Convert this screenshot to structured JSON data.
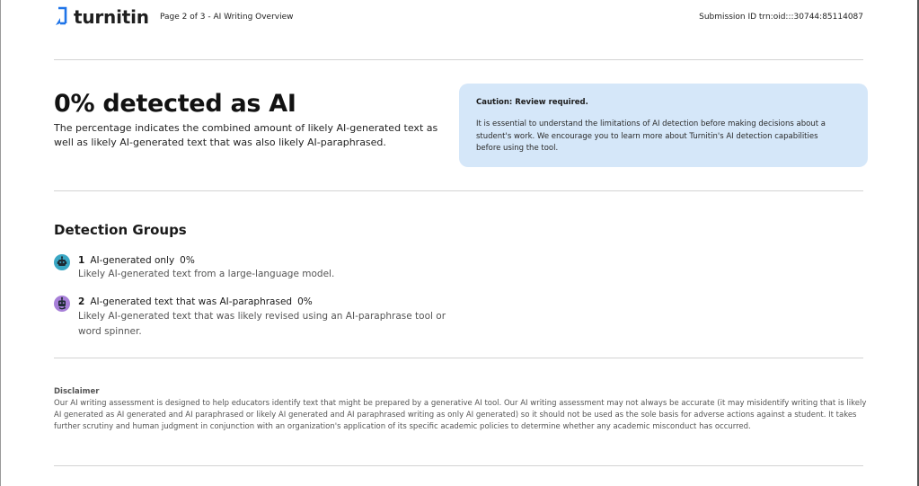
{
  "header": {
    "brand": "turnitin",
    "page_info": "Page 2 of 3 - AI Writing Overview",
    "submission_id": "Submission ID trn:oid:::30744:85114087"
  },
  "summary": {
    "headline": "0% detected as AI",
    "description": "The percentage indicates the combined amount of likely AI-generated text as well as likely AI-generated text that was also likely AI-paraphrased."
  },
  "caution": {
    "title": "Caution: Review required.",
    "body": "It is essential to understand the limitations of AI detection before making decisions about a student's work. We encourage you to learn more about Turnitin's AI detection capabilities before using the tool."
  },
  "detection_groups": {
    "title": "Detection Groups",
    "items": [
      {
        "number": "1",
        "label": "AI-generated only",
        "percent": "0%",
        "description": "Likely AI-generated text from a large-language model.",
        "icon": "robot-icon",
        "color": "#3aa7c4"
      },
      {
        "number": "2",
        "label": "AI-generated text that was AI-paraphrased",
        "percent": "0%",
        "description": "Likely AI-generated text that was likely revised using an AI-paraphrase tool or word spinner.",
        "icon": "robot-paraphrase-icon",
        "color": "#a77fd8"
      }
    ]
  },
  "disclaimer": {
    "title": "Disclaimer",
    "body": "Our AI writing assessment is designed to help educators identify text that might be prepared by a generative AI tool. Our AI writing assessment may not always be accurate (it may misidentify writing that is likely AI generated as AI generated and AI paraphrased or likely AI generated and AI paraphrased writing as only AI generated) so it should not be used as the sole basis for adverse actions against a student. It takes further scrutiny and human judgment in conjunction with an organization's application of its specific academic policies to determine whether any academic misconduct has occurred."
  },
  "colors": {
    "brand_blue": "#1f74e8",
    "caution_bg": "#d5e7f9"
  }
}
